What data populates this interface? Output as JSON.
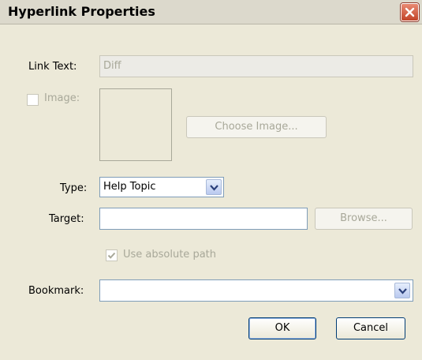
{
  "window": {
    "title": "Hyperlink Properties"
  },
  "link_text": {
    "label": "Link Text:",
    "value": "Diff"
  },
  "image": {
    "label": "Image:",
    "checked": false,
    "choose_button": "Choose Image..."
  },
  "type": {
    "label": "Type:",
    "value": "Help Topic"
  },
  "target": {
    "label": "Target:",
    "value": "",
    "browse_button": "Browse..."
  },
  "absolute_path": {
    "label": "Use absolute path",
    "checked": true
  },
  "bookmark": {
    "label": "Bookmark:",
    "value": ""
  },
  "buttons": {
    "ok": "OK",
    "cancel": "Cancel"
  },
  "colors": {
    "disabled_text": "#a8a899",
    "dialog_bg": "#ece9d8",
    "accent_border": "#003c74"
  }
}
